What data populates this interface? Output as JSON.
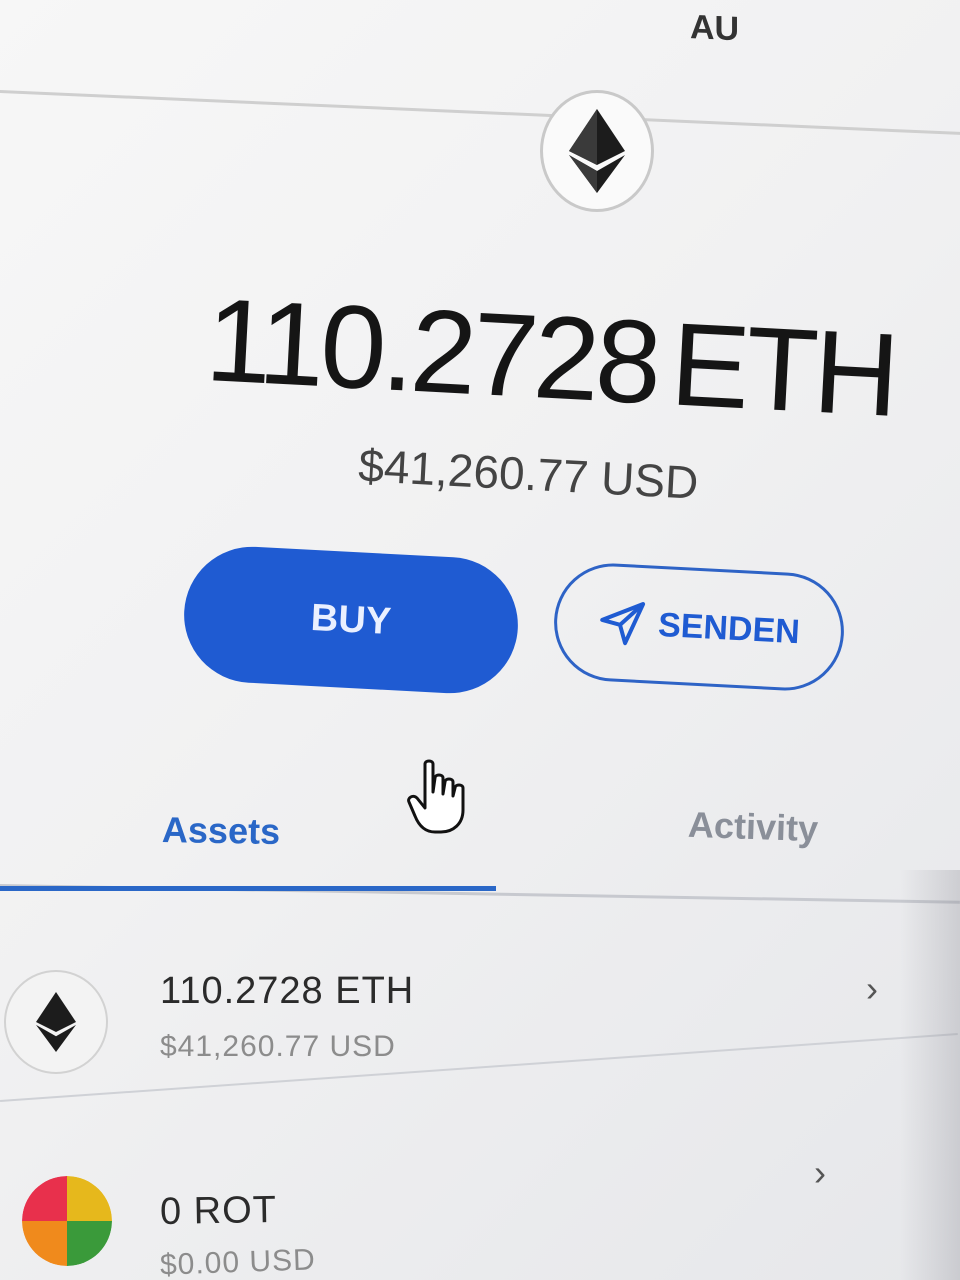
{
  "header": {
    "partial_text": "AU"
  },
  "token": {
    "icon": "ethereum-icon",
    "balance_amount": "110.2728",
    "balance_unit": "ETH",
    "fiat_value": "$41,260.77 USD"
  },
  "actions": {
    "buy_label": "BUY",
    "send_label": "SENDEN",
    "send_icon": "paper-plane-icon"
  },
  "tabs": [
    {
      "label": "Assets",
      "active": true
    },
    {
      "label": "Activity",
      "active": false
    }
  ],
  "assets": [
    {
      "amount": "110.2728 ETH",
      "fiat": "$41,260.77 USD",
      "icon": "ethereum-icon"
    },
    {
      "amount": "0 ROT",
      "fiat": "$0.00 USD",
      "icon": "rot-token-icon"
    }
  ],
  "colors": {
    "accent": "#1f5bd2",
    "tab_active": "#2a67c7",
    "tab_inactive": "#8a8f99"
  }
}
